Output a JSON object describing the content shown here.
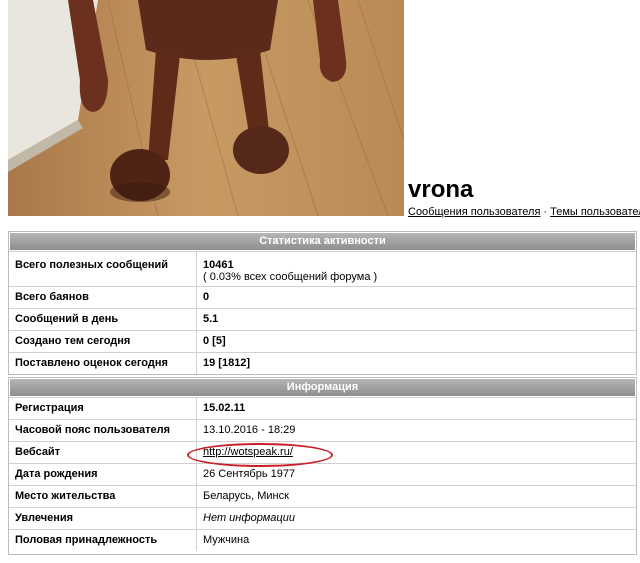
{
  "profile": {
    "username": "vrona",
    "links": [
      "Сообщения пользователя",
      "Темы пользователя"
    ],
    "link_separator": "·"
  },
  "activity": {
    "header": "Статистика активности",
    "rows": [
      {
        "label": "Всего полезных сообщений",
        "value": "10461",
        "sub": "( 0.03% всех сообщений форума )"
      },
      {
        "label": "Всего баянов",
        "value": "0"
      },
      {
        "label": "Сообщений в день",
        "value": "5.1"
      },
      {
        "label": "Создано тем сегодня",
        "value": "0 [5]"
      },
      {
        "label": "Поставлено оценок сегодня",
        "value": "19 [1812]"
      }
    ]
  },
  "info": {
    "header": "Информация",
    "rows": [
      {
        "label": "Регистрация",
        "value": "15.02.11"
      },
      {
        "label": "Часовой пояс пользователя",
        "value": "13.10.2016 - 18:29"
      },
      {
        "label": "Вебсайт",
        "value": "http://wotspeak.ru/"
      },
      {
        "label": "Дата рождения",
        "value": "26 Сентябрь 1977"
      },
      {
        "label": "Место жительства",
        "value": "Беларусь, Минск"
      },
      {
        "label": "Увлечения",
        "value": "Нет информации"
      },
      {
        "label": "Половая принадлежность",
        "value": "Мужчина"
      }
    ]
  },
  "colors": {
    "panel_header_top": "#b5b5b5",
    "panel_header_bottom": "#8e8e8e",
    "annotation_ellipse": "#c8202a"
  }
}
